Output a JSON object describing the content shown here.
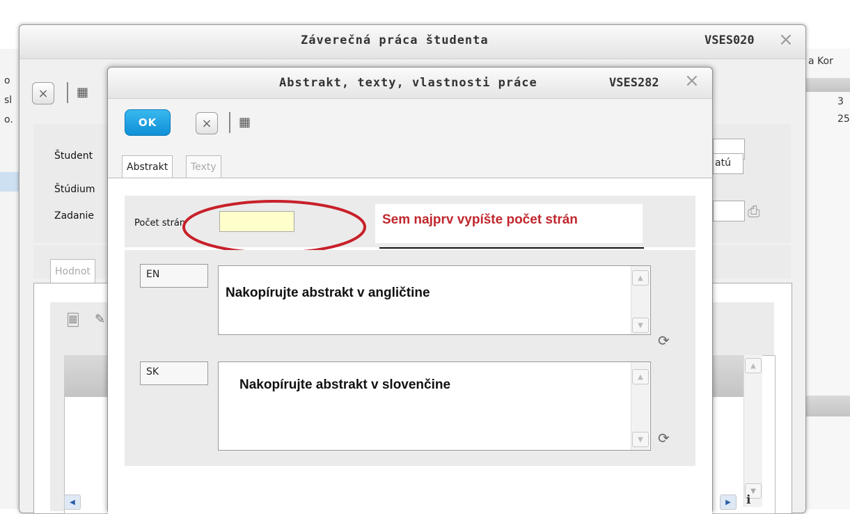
{
  "background": {
    "right_header": "a Kor",
    "right_values": [
      "3",
      "25"
    ],
    "left_fragments": [
      "o",
      "sl",
      "o."
    ]
  },
  "outer_dialog": {
    "title": "Záverečná práca študenta",
    "code": "VSES020",
    "labels": {
      "student": "Študent",
      "studium": "Štúdium",
      "zadanie": "Zadanie"
    },
    "studium_suffix": "atú",
    "tab_label": "Hodnot",
    "close_symbol": "×"
  },
  "inner_dialog": {
    "title": "Abstrakt, texty, vlastnosti práce",
    "code": "VSES282",
    "ok_label": "OK",
    "tabs": [
      {
        "label": "Abstrakt",
        "active": true
      },
      {
        "label": "Texty",
        "active": false
      }
    ],
    "pages_label": "Počet strán",
    "pages_value": "",
    "annotation": "Sem najprv vypíšte počet strán",
    "abstracts": [
      {
        "lang": "EN",
        "text": "Nakopírujte abstrakt v angličtine"
      },
      {
        "lang": "SK",
        "text": "Nakopírujte abstrakt v slovenčine"
      }
    ]
  },
  "colors": {
    "accent_blue": "#1ea3e4",
    "annotation_red": "#c0272d",
    "highlight_field": "#ffffcc"
  }
}
